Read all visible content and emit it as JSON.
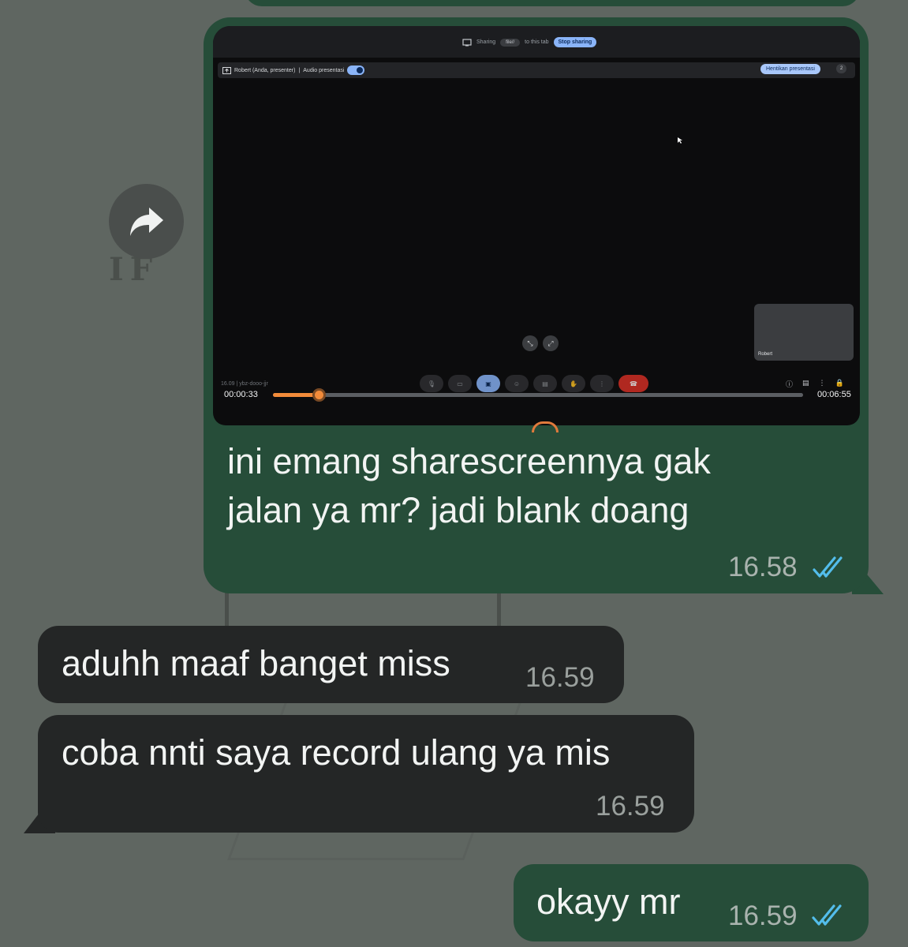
{
  "screen": {
    "background": "#5f6661"
  },
  "media_message": {
    "screenshot": {
      "sharing_banner": {
        "prefix": "Sharing",
        "tab": "file//",
        "suffix": "to this tab",
        "stop_label": "Stop sharing"
      },
      "presenter_label": "Robert (Anda, presenter)",
      "audio_label": "Audio presentasi",
      "stop_presenting_label": "Hentikan presentasi",
      "participant_count": "2",
      "tile_name": "Robert",
      "meet_code": "16.09 | ybz-dooo-jjr",
      "video_current_time": "00:00:33",
      "video_duration": "00:06:55",
      "progress": 0.086,
      "accent_color": "#f28b3a"
    },
    "caption_line1": "ini emang sharescreennya gak",
    "caption_line2": "jalan ya mr? jadi blank doang",
    "time": "16.58",
    "status": "read"
  },
  "messages": [
    {
      "direction": "in",
      "text": "aduhh maaf banget miss",
      "time": "16.59"
    },
    {
      "direction": "in",
      "text": "coba nnti saya record ulang ya mis",
      "time": "16.59"
    },
    {
      "direction": "out",
      "text": "okayy mr",
      "time": "16.59",
      "status": "read"
    }
  ],
  "colors": {
    "outgoing_bubble": "#264d39",
    "incoming_bubble": "#242626",
    "read_ticks": "#53bdeb"
  },
  "icons": [
    "forward-icon",
    "read-receipt-icon",
    "present-icon",
    "cursor-icon"
  ]
}
